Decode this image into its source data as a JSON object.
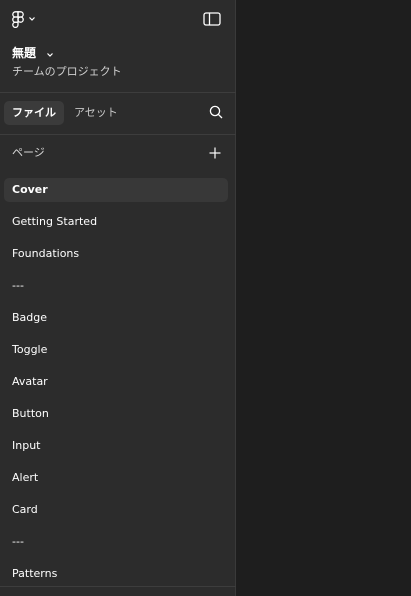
{
  "file": {
    "title": "無題",
    "project": "チームのプロジェクト"
  },
  "tabs": [
    {
      "label": "ファイル",
      "active": true
    },
    {
      "label": "アセット",
      "active": false
    }
  ],
  "pages": {
    "label": "ページ",
    "items": [
      {
        "label": "Cover",
        "selected": true
      },
      {
        "label": "Getting Started",
        "selected": false
      },
      {
        "label": "Foundations",
        "selected": false
      },
      {
        "label": "---",
        "selected": false
      },
      {
        "label": "Badge",
        "selected": false
      },
      {
        "label": "Toggle",
        "selected": false
      },
      {
        "label": "Avatar",
        "selected": false
      },
      {
        "label": "Button",
        "selected": false
      },
      {
        "label": "Input",
        "selected": false
      },
      {
        "label": "Alert",
        "selected": false
      },
      {
        "label": "Card",
        "selected": false
      },
      {
        "label": "---",
        "selected": false
      },
      {
        "label": "Patterns",
        "selected": false
      }
    ]
  },
  "icons": {
    "menu": "figma-logo-icon",
    "menu_dropdown": "chevron-down-icon",
    "panel_toggle": "sidebar-toggle-icon",
    "title_dropdown": "chevron-down-icon",
    "search": "search-icon",
    "add_page": "plus-icon"
  },
  "colors": {
    "sidebar_bg": "#2c2c2c",
    "canvas_bg": "#1e1e1e",
    "selected_bg": "#383838",
    "active_tab_bg": "#3b3b3b",
    "text": "#ffffff",
    "muted_text": "#d0d0d0"
  }
}
